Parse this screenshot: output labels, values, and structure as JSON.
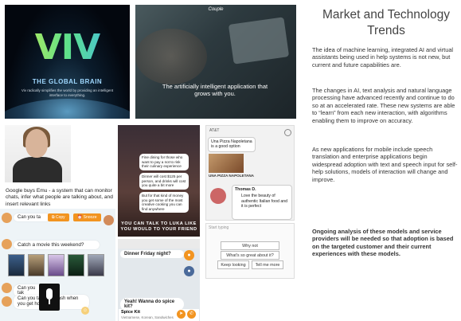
{
  "viv": {
    "logo": "VIV",
    "tagline": "THE GLOBAL BRAIN",
    "sub": "Viv radically simplifies the world by providing an intelligent interface to everything."
  },
  "couple": {
    "brand": "Couple",
    "caption": "The artificially intelligent application that grows with you."
  },
  "right": {
    "title": "Market and Technology Trends",
    "p1": "The idea of machine learning, integrated AI and virtual assistants being used in help systems is not new, but current and future capabilities are.",
    "p2": "The changes in AI, text analysis and natural language processing have advanced recently and continue to do so at an accelerated rate. These new systems are able to “learn” from each new interaction, with algorithms enabling them to improve on accuracy.",
    "p3": "As new applications for mobile include speech translation and enterprise applications begin widespread adoption with text and speech input for self-help solutions, models of interaction will change and improve.",
    "p4": "Ongoing analysis of these models and service providers will be needed so that adoption is based on the targeted customer and their current experiences with these models."
  },
  "emu": {
    "text": "Google buys Emu - a system that can monitor chats, infer what people are talking about, and insert relevant links"
  },
  "allo": {
    "b1": "Can you ta",
    "copy": "Copy",
    "snooze": "Snooze",
    "b2": "Catch a movie this weekend?",
    "b3": "Can you tak",
    "b4": "Can you take the trash when you get home?"
  },
  "luka": {
    "m1": "Fine dining for those who want to pay a not to risk their culinary experience",
    "m2": "Dinner will cost $125 per person, and drinks will cost you quite a bit more",
    "m3": "But for that kind of money you get some of the most creative cooking you can find anywhere",
    "caption": "YOU CAN TALK TO LUKA LIKE YOU WOULD TO YOUR FRIEND"
  },
  "messenger": {
    "m1": "Dinner Friday night?",
    "m2": "Yeah! Wanna do spice kit?",
    "place": "Spice Kit",
    "place_sub": "Vietnamese, Korean, Sandwiches"
  },
  "foursquare": {
    "status": "AT&T",
    "b1": "Una Pizza Napoletana is a good option",
    "card": "UNA PIZZA NAPOLETANA",
    "user": "Thomas D.",
    "quote": "Love the beauty of authentic Italian food and it is perfect",
    "input": "Start typing",
    "r1": "Why not",
    "r2": "What's so great about it?",
    "r3": "Keep looking",
    "r4": "Tell me more"
  }
}
